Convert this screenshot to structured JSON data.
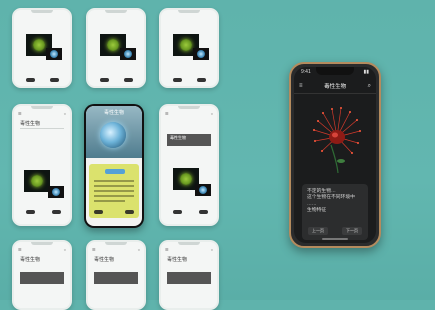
{
  "thumbnails": {
    "title_fragment_1": "毒性生物",
    "title_fragment_2": "毒性生物",
    "title_fragment_3": "毒性生物",
    "title_fragment_4": "毒性生物",
    "title_fragment_5": "毒性生物",
    "title_fragment_6": "毒性生物"
  },
  "hero": {
    "header": "毒性生物"
  },
  "big_phone": {
    "status_time": "9:41",
    "title": "毒性生物",
    "card_lines": [
      "不定的生物…",
      "这个生物在不同环境中",
      "……",
      "生物特征"
    ],
    "left_button": "上一页",
    "right_button": "下一页"
  },
  "colors": {
    "background": "#5fb3ac",
    "accent_yellow": "#dbe26d",
    "frame_gold": "#b48b5e"
  }
}
